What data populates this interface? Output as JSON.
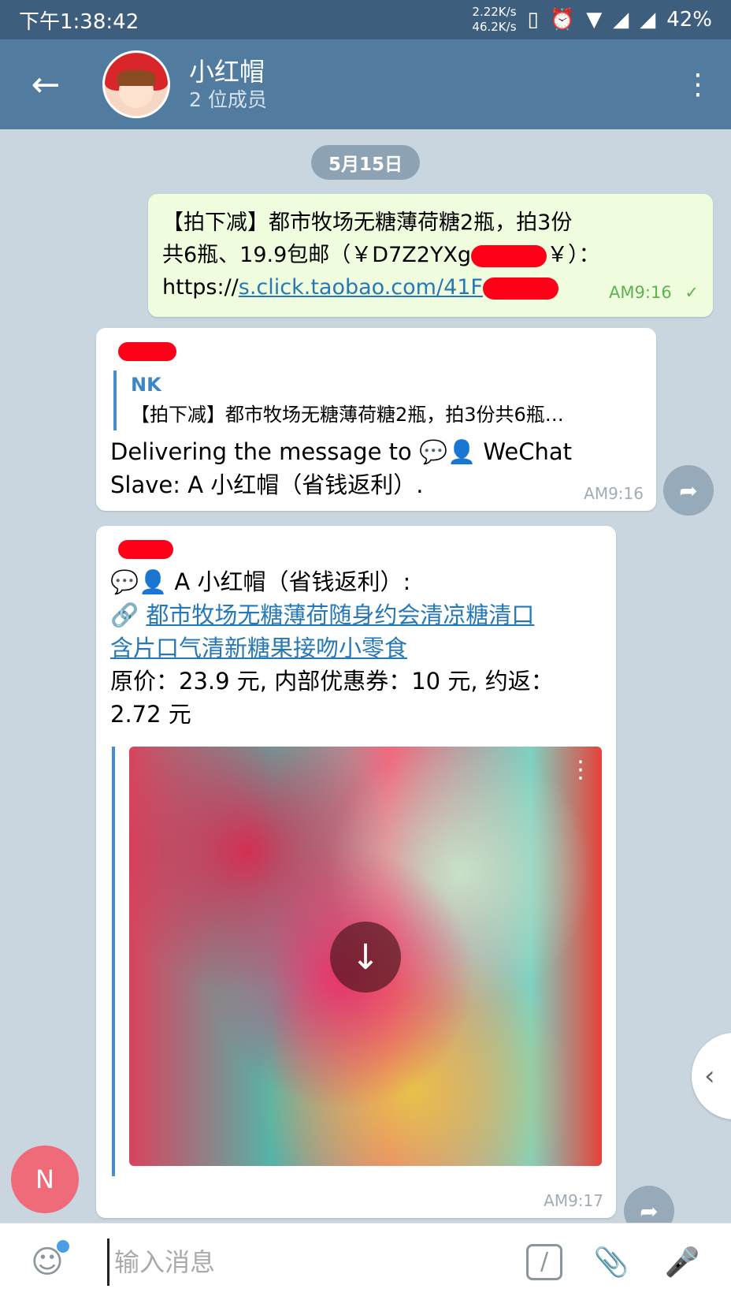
{
  "status_bar": {
    "time": "下午1:38:42",
    "upload_speed": "2.22K/s",
    "download_speed": "46.2K/s",
    "battery": "42%"
  },
  "header": {
    "title": "小红帽",
    "subtitle": "2 位成员"
  },
  "date_separator": "5月15日",
  "messages": {
    "outgoing": {
      "line1": "【拍下减】都市牧场无糖薄荷糖2瓶，拍3份",
      "line2_prefix": "共6瓶、19.9包邮（￥D7Z2YXg",
      "line2_suffix": "￥）：",
      "link_prefix": "https://",
      "link_text": "s.click.taobao.com/41F",
      "time": "AM9:16",
      "check": "✓"
    },
    "reply": {
      "quote_name": "NK",
      "quote_text": "【拍下减】都市牧场无糖薄荷糖2瓶，拍3份共6瓶…",
      "text_line1": "Delivering the message to 💬👤 WeChat",
      "text_line2": "Slave: A 小红帽（省钱返利）.",
      "time": "AM9:16"
    },
    "product": {
      "sender_line": "💬👤 A 小红帽（省钱返利）:",
      "link_icon": "🔗",
      "link_text_1": "都市牧场无糖薄荷随身约会清凉糖清口",
      "link_text_2": "含片口气清新糖果接吻小零食",
      "price_line1": "原价：23.9 元, 内部优惠券：10 元, 约返：",
      "price_line2": "2.72 元",
      "time": "AM9:17"
    }
  },
  "fab_user_initial": "N",
  "input": {
    "placeholder": "输入消息"
  },
  "icons": {
    "back": "arrow-left",
    "more": "more-vertical",
    "share": "share-arrow",
    "download": "download-arrow",
    "sticker": "sticker",
    "bot_command": "slash",
    "attach": "paperclip",
    "mic": "microphone"
  }
}
